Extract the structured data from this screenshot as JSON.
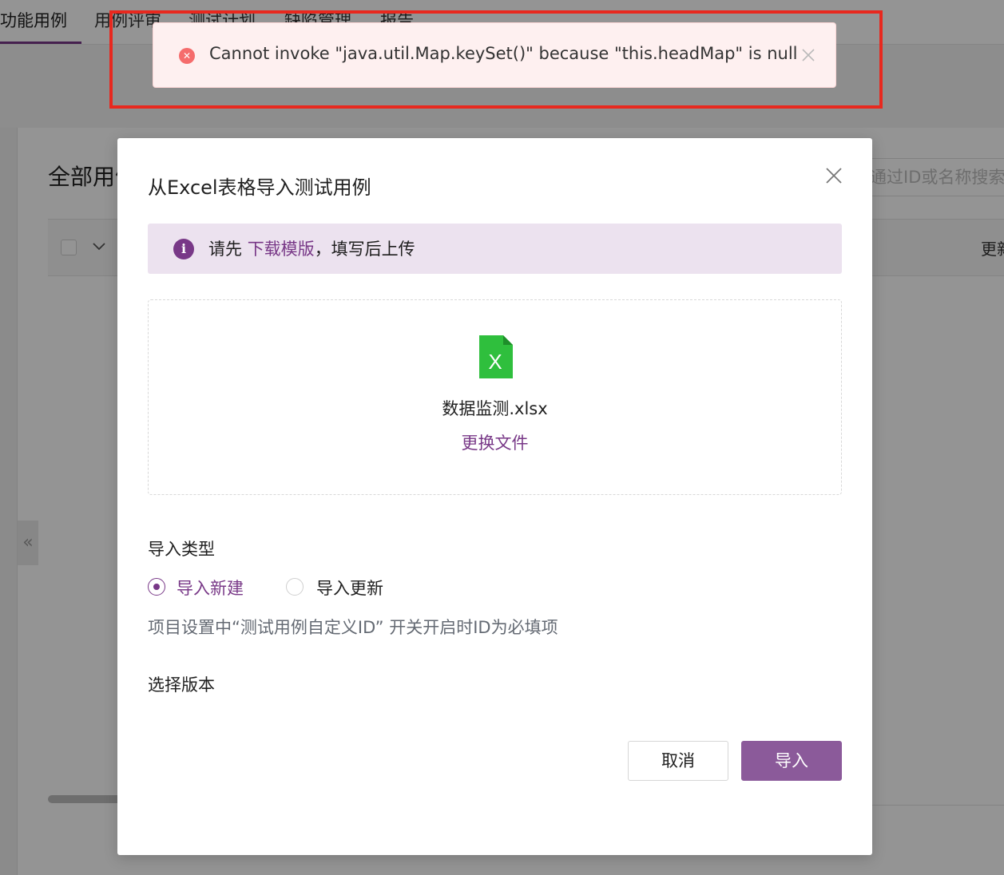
{
  "background": {
    "tabs": [
      "功能用例",
      "用例评审",
      "测试计划",
      "缺陷管理",
      "报告"
    ],
    "page_title": "全部用例",
    "search_placeholder": "通过ID或名称搜索",
    "table_column_more": "更新"
  },
  "toast": {
    "message": "Cannot invoke \"java.util.Map.keySet()\" because \"this.headMap\" is null",
    "icon": "error-circle-icon"
  },
  "dialog": {
    "title": "从Excel表格导入测试用例",
    "info": {
      "prefix": "请先",
      "link": "下载模版",
      "suffix": "，填写后上传"
    },
    "upload": {
      "file_icon_letter": "X",
      "file_name": "数据监测.xlsx",
      "replace_label": "更换文件"
    },
    "import_type_label": "导入类型",
    "import_options": [
      {
        "label": "导入新建",
        "checked": true
      },
      {
        "label": "导入更新",
        "checked": false
      }
    ],
    "hint": "项目设置中“测试用例自定义ID” 开关开启时ID为必填项",
    "version_label": "选择版本",
    "cancel_label": "取消",
    "import_label": "导入"
  },
  "colors": {
    "accent": "#783887",
    "primary_button": "#8b5a9a",
    "error": "#f56c6c",
    "highlight_box": "#e8281e",
    "excel_green": "#2fbf3d"
  }
}
